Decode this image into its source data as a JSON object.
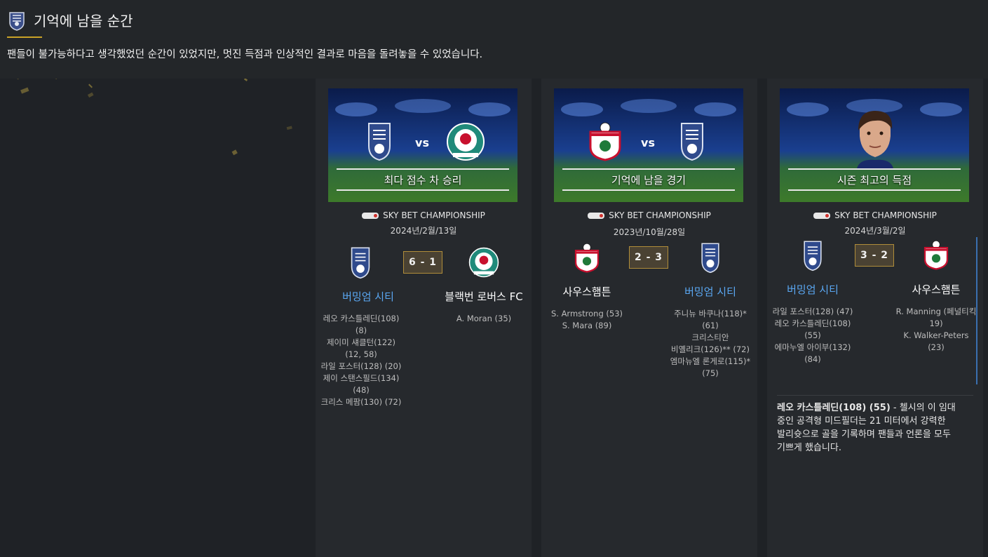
{
  "header": {
    "title": "기억에 남을 순간",
    "subtitle": "팬들이 불가능하다고 생각했었던 순간이 있었지만, 멋진 득점과 인상적인 결과로 마음을 돌려놓을 수 있었습니다."
  },
  "colors": {
    "accent_gold": "#c9a227",
    "our_team": "#5aa7f2",
    "score_bg": "#4a4233",
    "score_border": "#b08d3a"
  },
  "cards": [
    {
      "caption": "최다 점수 차 승리",
      "vs_label": "vs",
      "competition": "SKY BET CHAMPIONSHIP",
      "date": "2024년/2월/13일",
      "score": "6 - 1",
      "home_team": "버밍엄 시티",
      "away_team": "블랙번 로버스 FC",
      "home_scorers": [
        "레오 카스틀레딘(108)",
        "(8)",
        "제이미 섀클턴(122)",
        "(12, 58)",
        "라일 포스터(128) (20)",
        "제이 스탠스필드(134)",
        "(48)",
        "크리스 메팜(130) (72)"
      ],
      "away_scorers": [
        "A. Moran (35)"
      ]
    },
    {
      "caption": "기억에 남을 경기",
      "vs_label": "vs",
      "competition": "SKY BET CHAMPIONSHIP",
      "date": "2023년/10월/28일",
      "score": "2 - 3",
      "home_team": "사우스햄튼",
      "away_team": "버밍엄 시티",
      "home_scorers": [
        "S. Armstrong (53)",
        "S. Mara (89)"
      ],
      "away_scorers": [
        "주니뉴 바쿠나(118)*",
        "(61)",
        "크리스티안",
        "비옐리크(126)** (72)",
        "엠마뉴엘 론게로(115)*",
        "(75)"
      ]
    },
    {
      "caption": "시즌 최고의 득점",
      "competition": "SKY BET CHAMPIONSHIP",
      "date": "2024년/3월/2일",
      "score": "3 - 2",
      "home_team": "버밍엄 시티",
      "away_team": "사우스햄튼",
      "home_scorers": [
        "라일 포스터(128) (47)",
        "레오 카스틀레딘(108)",
        "(55)",
        "에마누엘 아이부(132)",
        "(84)"
      ],
      "away_scorers": [
        "R. Manning (페널티킥",
        "19)",
        "K. Walker-Peters",
        "(23)"
      ],
      "description_bold": "레오 카스틀레딘(108) (55)",
      "description_lines": [
        " - 첼시의 이 임대",
        "중인 공격형 미드필더는 21 미터에서 강력한",
        "발리슛으로 골을 기록하며 팬들과 언론을 모두",
        "기쁘게 했습니다."
      ]
    }
  ]
}
